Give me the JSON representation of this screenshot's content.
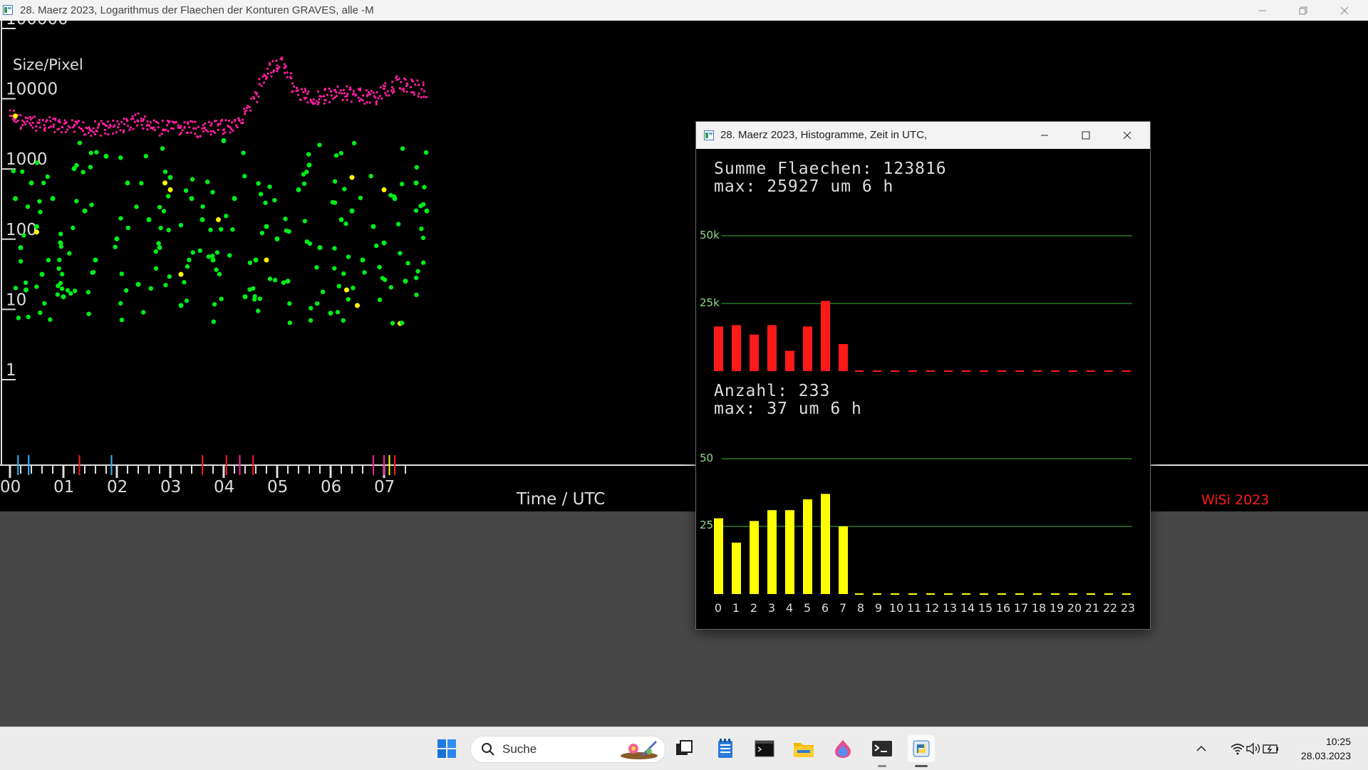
{
  "main_window": {
    "title": "28. Maerz 2023, Logarithmus der Flaechen der Konturen GRAVES, alle -M",
    "y_unit_label": "Size/Pixel",
    "y_tick_labels": [
      "100000",
      "10000",
      "1000",
      "100",
      "10",
      "1"
    ],
    "x_tick_labels": [
      "00",
      "01",
      "02",
      "03",
      "04",
      "05",
      "06",
      "07"
    ],
    "x_axis_label": "Time / UTC",
    "credit": "WiSi 2023",
    "colors": {
      "magenta": "#ff1f9f",
      "green": "#00ee1a",
      "yellow": "#ffff00",
      "red": "#ff1a1a",
      "cyan": "#33bbff"
    }
  },
  "hist_window": {
    "title": "28. Maerz 2023, Histogramme, Zeit in UTC,",
    "area_line1": "Summe Flaechen: 123816",
    "area_line2": "max: 25927 um 6 h",
    "count_line1": "Anzahl: 233",
    "count_line2": "max: 37 um 6 h",
    "area_grid_labels": [
      "50k",
      "25k"
    ],
    "count_grid_labels": [
      "50",
      "25"
    ],
    "hour_labels": [
      "0",
      "1",
      "2",
      "3",
      "4",
      "5",
      "6",
      "7",
      "8",
      "9",
      "10",
      "11",
      "12",
      "13",
      "14",
      "15",
      "16",
      "17",
      "18",
      "19",
      "20",
      "21",
      "22",
      "23"
    ]
  },
  "chart_data": [
    {
      "type": "scatter",
      "title": "28. Maerz 2023, Logarithmus der Flaechen der Konturen GRAVES, alle -M",
      "xlabel": "Time / UTC",
      "ylabel": "Size/Pixel",
      "y_scale": "log",
      "ylim": [
        1,
        100000
      ],
      "xlim": [
        0,
        7.9
      ],
      "x_ticks": [
        "00",
        "01",
        "02",
        "03",
        "04",
        "05",
        "06",
        "07"
      ],
      "series": [
        {
          "color": "#ff1f9f",
          "description_values": "dense band",
          "x": [
            0.0,
            0.3,
            0.6,
            0.9,
            1.2,
            1.5,
            1.8,
            2.1,
            2.4,
            2.7,
            3.0,
            3.3,
            3.6,
            3.9,
            4.2,
            4.5,
            4.8,
            5.1,
            5.4,
            5.7,
            6.0,
            6.3,
            6.6,
            6.9,
            7.2,
            7.5,
            7.8
          ],
          "y": [
            4500,
            3500,
            3500,
            3200,
            3000,
            3000,
            3000,
            3200,
            4000,
            3000,
            3000,
            3000,
            2800,
            3000,
            3500,
            5500,
            20000,
            25000,
            9000,
            8000,
            9000,
            9500,
            8500,
            8500,
            13000,
            12000,
            10000
          ]
        },
        {
          "color": "#00ee1a",
          "x": [
            0.1,
            0.2,
            0.3,
            0.4,
            0.5,
            0.6,
            0.8,
            1.0,
            1.2,
            1.4,
            1.6,
            1.8,
            2.0,
            2.2,
            2.4,
            2.6,
            2.8,
            3.0,
            3.2,
            3.4,
            3.6,
            3.8,
            4.0,
            4.2,
            4.4,
            4.6,
            4.8,
            5.0,
            5.2,
            5.4,
            5.6,
            5.8,
            6.0,
            6.2,
            6.4,
            6.6,
            6.8,
            7.0,
            7.2,
            7.4,
            7.6,
            7.8
          ],
          "y": [
            300,
            60,
            15,
            500,
            120,
            25,
            300,
            12,
            800,
            200,
            40,
            1200,
            80,
            500,
            18,
            150,
            60,
            600,
            9,
            300,
            150,
            40,
            2000,
            300,
            12,
            40,
            120,
            80,
            20,
            400,
            900,
            60,
            7,
            150,
            200,
            40,
            120,
            70,
            300,
            20,
            500,
            200
          ]
        },
        {
          "color": "#ffff00",
          "x": [
            0.1,
            0.5,
            2.9,
            3.0,
            3.2,
            3.9,
            4.8,
            6.3,
            6.4,
            6.5,
            7.0,
            7.3
          ],
          "y": [
            4500,
            100,
            500,
            400,
            25,
            150,
            40,
            15,
            600,
            9,
            400,
            5
          ]
        }
      ]
    },
    {
      "type": "bar",
      "title": "Summe Flaechen: 123816",
      "categories": [
        "0",
        "1",
        "2",
        "3",
        "4",
        "5",
        "6",
        "7",
        "8",
        "9",
        "10",
        "11",
        "12",
        "13",
        "14",
        "15",
        "16",
        "17",
        "18",
        "19",
        "20",
        "21",
        "22",
        "23"
      ],
      "values": [
        16500,
        17000,
        13500,
        17000,
        7500,
        16500,
        25927,
        10000,
        0,
        0,
        0,
        0,
        0,
        0,
        0,
        0,
        0,
        0,
        0,
        0,
        0,
        0,
        0,
        0
      ],
      "ylim": [
        0,
        50000
      ],
      "color": "#ff1a1a"
    },
    {
      "type": "bar",
      "title": "Anzahl: 233",
      "categories": [
        "0",
        "1",
        "2",
        "3",
        "4",
        "5",
        "6",
        "7",
        "8",
        "9",
        "10",
        "11",
        "12",
        "13",
        "14",
        "15",
        "16",
        "17",
        "18",
        "19",
        "20",
        "21",
        "22",
        "23"
      ],
      "values": [
        28,
        19,
        27,
        31,
        31,
        35,
        37,
        25,
        0,
        0,
        0,
        0,
        0,
        0,
        0,
        0,
        0,
        0,
        0,
        0,
        0,
        0,
        0,
        0
      ],
      "ylim": [
        0,
        50
      ],
      "color": "#ffff00"
    }
  ],
  "taskbar": {
    "search_label": "Suche",
    "time": "10:25",
    "date": "28.03.2023"
  }
}
